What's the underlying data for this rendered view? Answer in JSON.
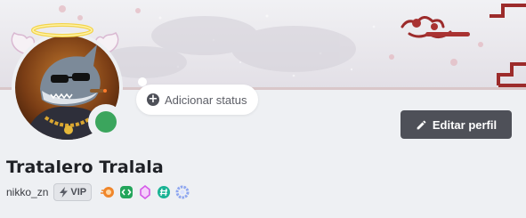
{
  "profile": {
    "display_name": "Tratalero Tralala",
    "username": "nikko_zn",
    "vip_label": "VIP",
    "online_status": "online",
    "status_color": "#3ba55d"
  },
  "status_bubble": {
    "label": "Adicionar status",
    "icon": "plus-circle-icon"
  },
  "actions": {
    "edit_profile_label": "Editar perfil",
    "edit_icon": "pencil-icon"
  },
  "badges": [
    {
      "name": "nitro-badge-icon",
      "color": "#f0862a"
    },
    {
      "name": "active-developer-badge-icon",
      "color": "#23a55a"
    },
    {
      "name": "boost-gem-badge-icon",
      "color": "#d459e8"
    },
    {
      "name": "hashtag-badge-icon",
      "color": "#1ab394"
    },
    {
      "name": "quest-ring-badge-icon",
      "color": "#8ea6f0"
    }
  ],
  "colors": {
    "background": "#eef0f3",
    "button": "#4e5058",
    "banner_accent": "#9c2b2b"
  }
}
